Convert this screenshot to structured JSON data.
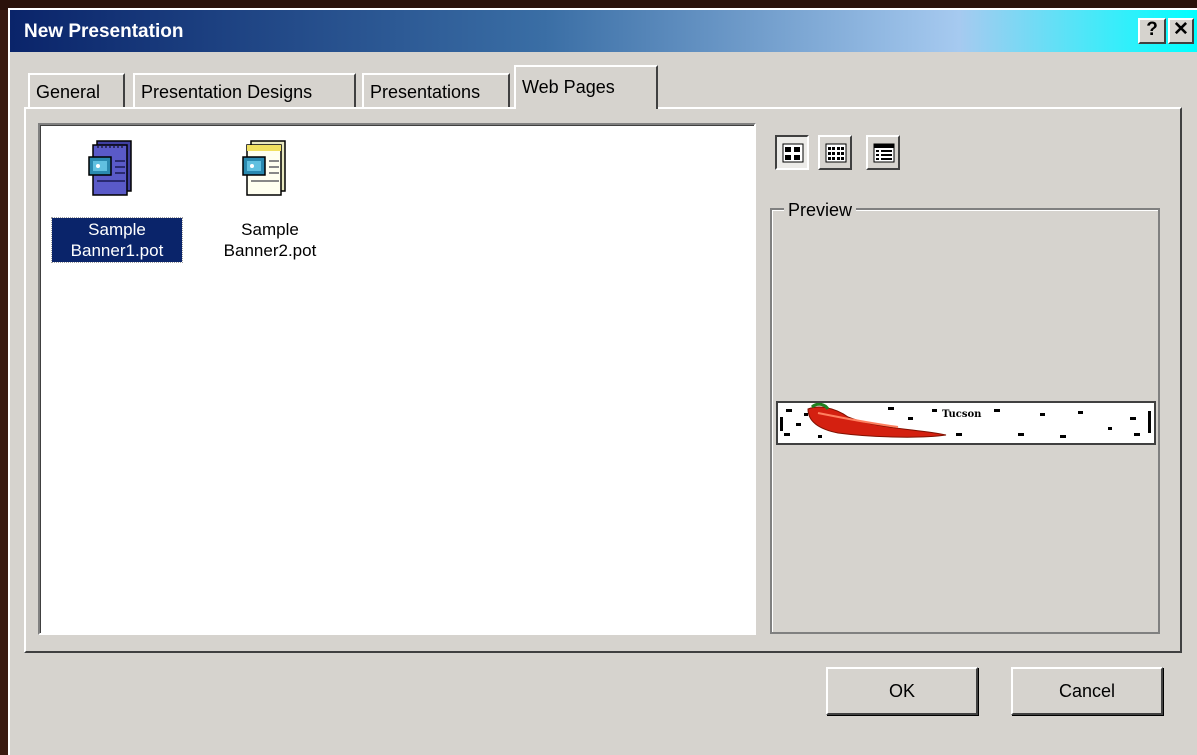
{
  "window": {
    "title": "New Presentation",
    "help_label": "?",
    "close_label": "✕"
  },
  "tabs": [
    {
      "label": "General",
      "selected": false
    },
    {
      "label": "Presentation Designs",
      "selected": false
    },
    {
      "label": "Presentations",
      "selected": false
    },
    {
      "label": "Web Pages",
      "selected": true
    }
  ],
  "files": [
    {
      "line1": "Sample",
      "line2": "Banner1.pot",
      "selected": true,
      "icon": "template-file-blue-icon"
    },
    {
      "line1": "Sample",
      "line2": "Banner2.pot",
      "selected": false,
      "icon": "template-file-yellow-icon"
    }
  ],
  "view_buttons": [
    {
      "icon": "large-icons-view-icon",
      "pressed": true
    },
    {
      "icon": "list-view-icon",
      "pressed": false
    },
    {
      "icon": "details-view-icon",
      "pressed": false
    }
  ],
  "preview": {
    "label": "Preview",
    "banner_text": "Tucson"
  },
  "buttons": {
    "ok": "OK",
    "cancel": "Cancel"
  },
  "colors": {
    "title_start": "#0a246a",
    "title_end": "#00ffff",
    "selection": "#0a246a",
    "dialog_face": "#d6d3ce"
  }
}
